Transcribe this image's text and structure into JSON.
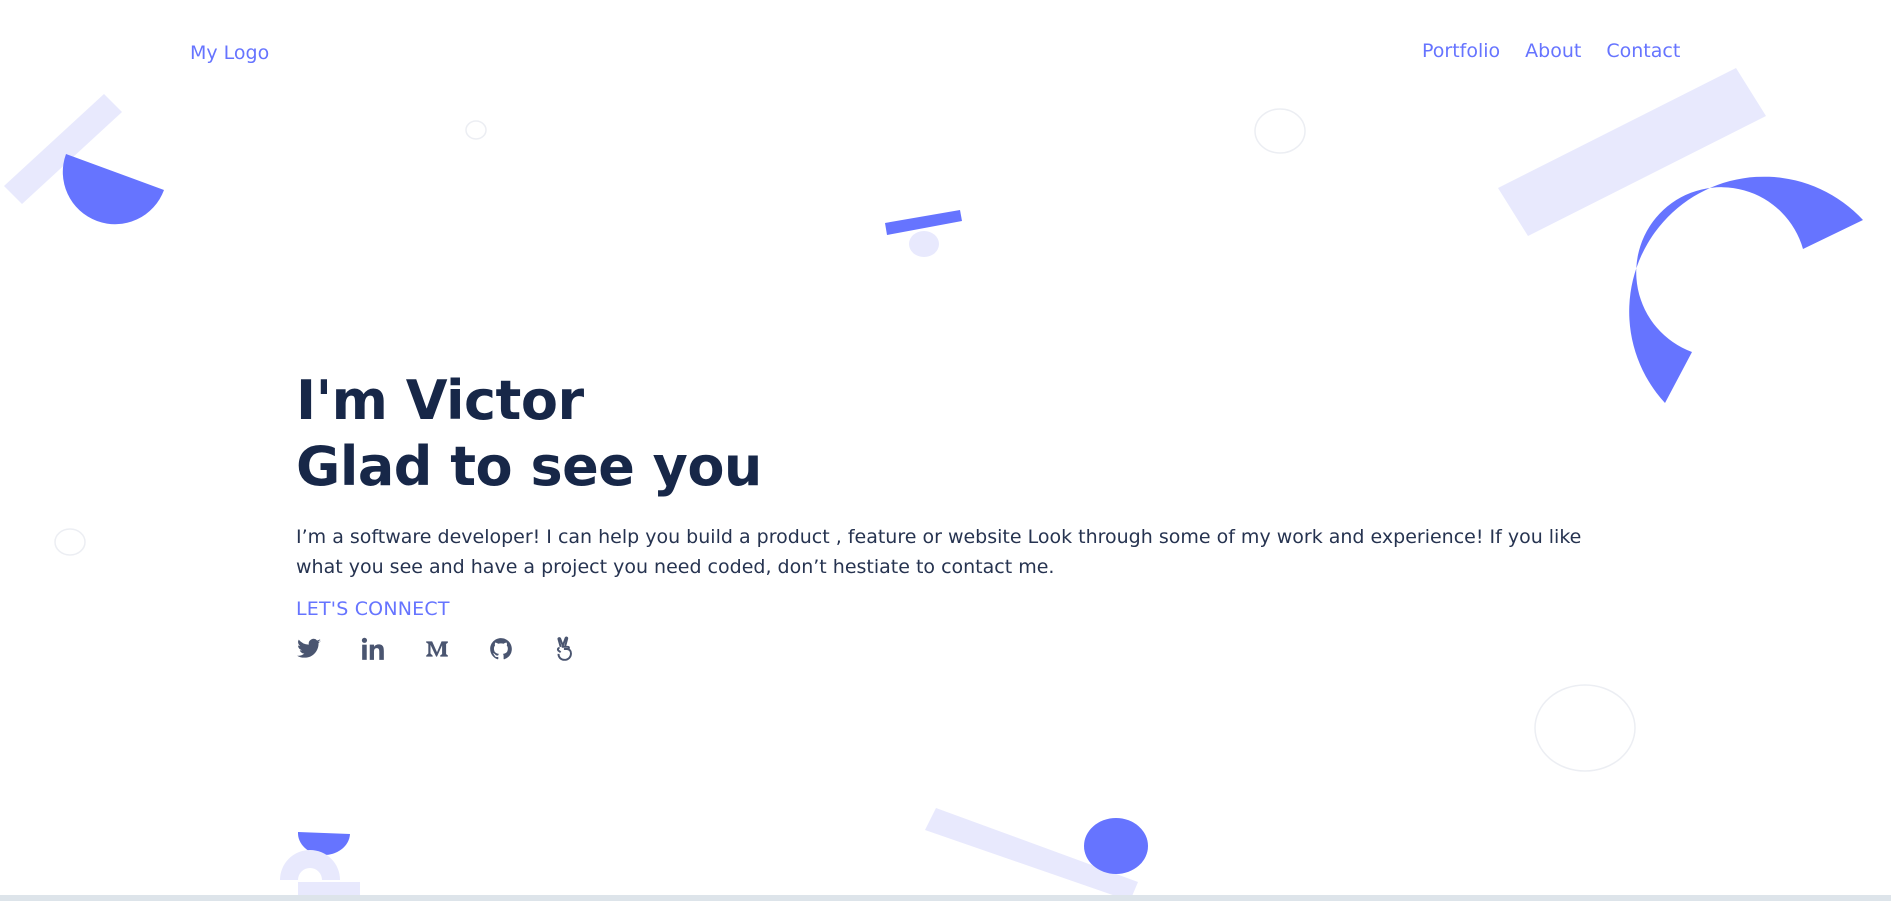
{
  "header": {
    "logo_text": "My Logo",
    "nav": [
      {
        "label": "Portfolio"
      },
      {
        "label": "About"
      },
      {
        "label": "Contact"
      }
    ]
  },
  "hero": {
    "title_line1": "I'm Victor",
    "title_line2": "Glad to see you",
    "description": "I’m a software developer! I can help you build a product , feature or website Look through some of my work and experience! If you like what you see and have a project you need coded, don’t hestiate to contact me.",
    "connect_label": "LET'S CONNECT",
    "social": [
      {
        "icon": "twitter-icon"
      },
      {
        "icon": "linkedin-icon"
      },
      {
        "icon": "medium-icon"
      },
      {
        "icon": "github-icon"
      },
      {
        "icon": "angellist-icon"
      }
    ]
  },
  "colors": {
    "accent": "#6674ff",
    "accent_light": "#e8e9fd",
    "heading": "#172748",
    "text": "#263350",
    "icon": "#4a5570"
  }
}
